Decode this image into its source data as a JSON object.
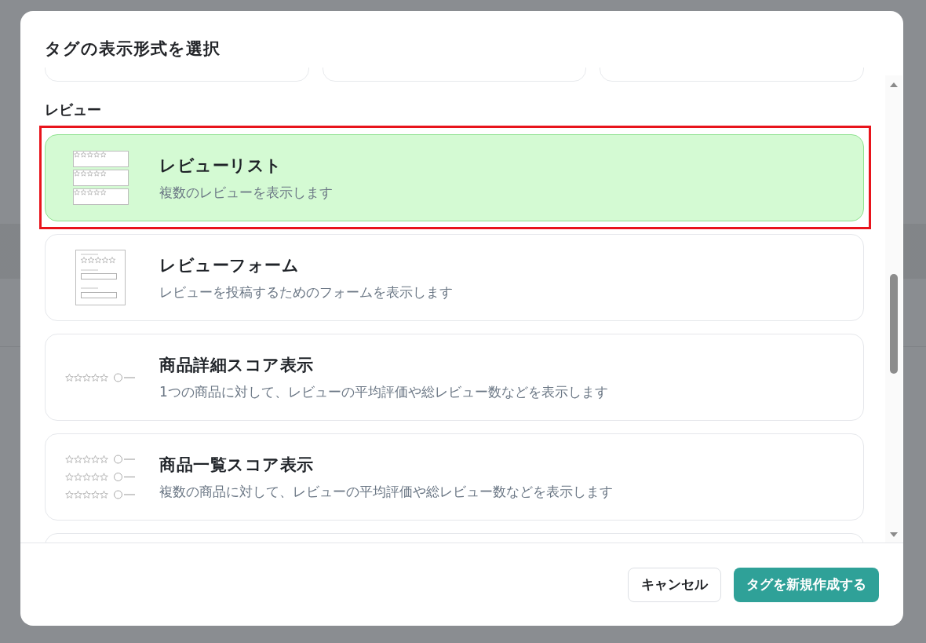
{
  "dialog": {
    "title": "タグの表示形式を選択"
  },
  "section": {
    "label": "レビュー"
  },
  "options": [
    {
      "kind": "list",
      "title": "レビューリスト",
      "description": "複数のレビューを表示します",
      "selected": true,
      "highlighted": true
    },
    {
      "kind": "form",
      "title": "レビューフォーム",
      "description": "レビューを投稿するためのフォームを表示します",
      "selected": false,
      "highlighted": false
    },
    {
      "kind": "score",
      "title": "商品詳細スコア表示",
      "description": "1つの商品に対して、レビューの平均評価や総レビュー数などを表示します",
      "selected": false,
      "highlighted": false
    },
    {
      "kind": "score-list",
      "title": "商品一覧スコア表示",
      "description": "複数の商品に対して、レビューの平均評価や総レビュー数などを表示します",
      "selected": false,
      "highlighted": false
    }
  ],
  "buttons": [
    {
      "kind": "secondary",
      "label": "キャンセル"
    },
    {
      "kind": "primary",
      "label": "タグを新規作成する"
    }
  ]
}
